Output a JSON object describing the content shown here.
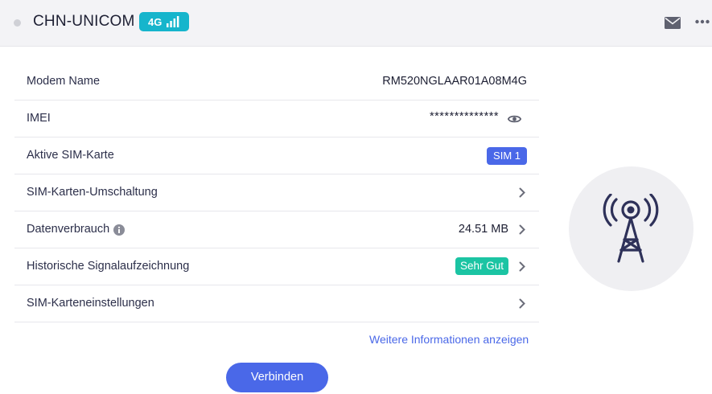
{
  "header": {
    "carrier": "CHN-UNICOM",
    "network_type": "4G"
  },
  "rows": [
    {
      "label": "Modem Name",
      "value": "RM520NGLAAR01A08M4G"
    },
    {
      "label": "IMEI",
      "value": "**************"
    },
    {
      "label": "Aktive SIM-Karte",
      "badge": "SIM 1"
    },
    {
      "label": "SIM-Karten-Umschaltung"
    },
    {
      "label": "Datenverbrauch",
      "value": "24.51 MB"
    },
    {
      "label": "Historische Signalaufzeichnung",
      "badge": "Sehr Gut"
    },
    {
      "label": "SIM-Karteneinstellungen"
    }
  ],
  "more_info_link": "Weitere Informationen anzeigen",
  "connect_button": "Verbinden",
  "colors": {
    "accent": "#4a68e8",
    "badge_4g": "#16b5cc",
    "good": "#1bc4a3",
    "header_bg": "#f3f3f6"
  },
  "icons": [
    "mail-icon",
    "more-icon",
    "eye-icon",
    "info-icon",
    "chevron-right-icon",
    "signal-tower-icon"
  ]
}
